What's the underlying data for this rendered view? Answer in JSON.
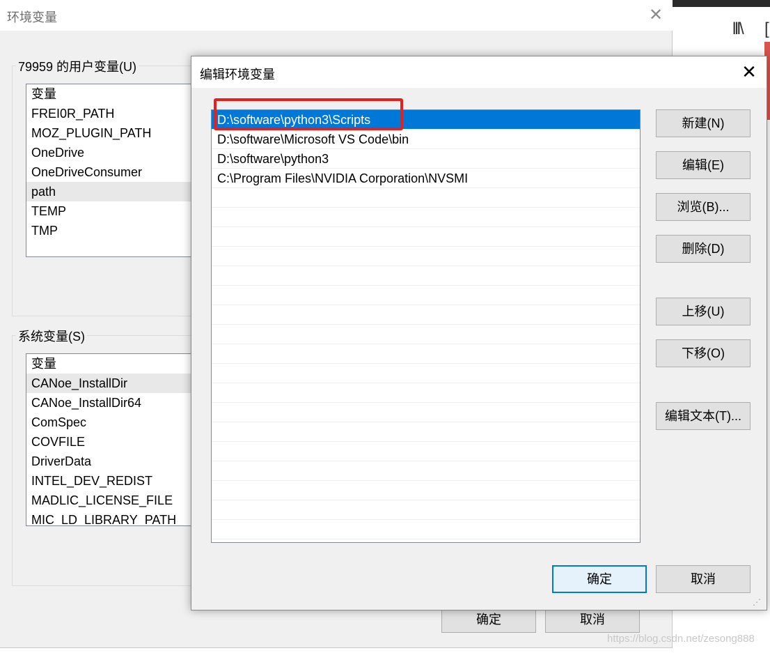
{
  "background": {
    "toolbar_icon_text": "lll\\",
    "toolbar_icon2_text": "[",
    "watermark": "https://blog.csdn.net/zesong888"
  },
  "parent_dialog": {
    "title": "环境变量",
    "close_glyph": "✕",
    "user_group_label": "79959 的用户变量(U)",
    "user_variables": [
      "变量",
      "FREI0R_PATH",
      "MOZ_PLUGIN_PATH",
      "OneDrive",
      "OneDriveConsumer",
      "path",
      "TEMP",
      "TMP"
    ],
    "system_group_label": "系统变量(S)",
    "system_variables": [
      "变量",
      "CANoe_InstallDir",
      "CANoe_InstallDir64",
      "ComSpec",
      "COVFILE",
      "DriverData",
      "INTEL_DEV_REDIST",
      "MADLIC_LICENSE_FILE",
      "MIC_LD_LIBRARY_PATH"
    ],
    "ok_label": "确定",
    "cancel_label": "取消"
  },
  "edit_dialog": {
    "title": "编辑环境变量",
    "close_glyph": "✕",
    "paths": [
      "D:\\software\\python3\\Scripts",
      "D:\\software\\Microsoft VS Code\\bin",
      "D:\\software\\python3",
      "C:\\Program Files\\NVIDIA Corporation\\NVSMI"
    ],
    "selected_index": 0,
    "buttons": {
      "new": "新建(N)",
      "edit": "编辑(E)",
      "browse": "浏览(B)...",
      "delete": "删除(D)",
      "move_up": "上移(U)",
      "move_down": "下移(O)",
      "edit_text": "编辑文本(T)...",
      "ok": "确定",
      "cancel": "取消"
    },
    "highlight_color": "#e8201c",
    "selection_color": "#0078d7"
  }
}
